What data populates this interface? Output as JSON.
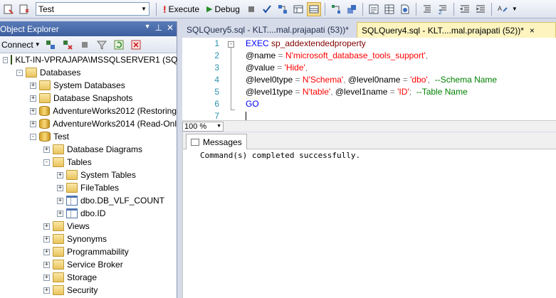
{
  "toolbar": {
    "database": "Test",
    "execute_label": "Execute",
    "debug_label": "Debug"
  },
  "object_explorer": {
    "title": "Object Explorer",
    "connect_label": "Connect",
    "nodes": [
      {
        "label": "KLT-IN-VPRAJAPA\\MSSQLSERVER1 (SQ",
        "expander": "-"
      },
      {
        "label": "Databases",
        "expander": "-"
      },
      {
        "label": "System Databases",
        "expander": "+"
      },
      {
        "label": "Database Snapshots",
        "expander": "+"
      },
      {
        "label": "AdventureWorks2012 (Restoring",
        "expander": "+"
      },
      {
        "label": "AdventureWorks2014 (Read-Onl",
        "expander": "+"
      },
      {
        "label": "Test",
        "expander": "-"
      },
      {
        "label": "Database Diagrams",
        "expander": "+"
      },
      {
        "label": "Tables",
        "expander": "-"
      },
      {
        "label": "System Tables",
        "expander": "+"
      },
      {
        "label": "FileTables",
        "expander": "+"
      },
      {
        "label": "dbo.DB_VLF_COUNT",
        "expander": "+"
      },
      {
        "label": "dbo.ID",
        "expander": "+"
      },
      {
        "label": "Views",
        "expander": "+"
      },
      {
        "label": "Synonyms",
        "expander": "+"
      },
      {
        "label": "Programmability",
        "expander": "+"
      },
      {
        "label": "Service Broker",
        "expander": "+"
      },
      {
        "label": "Storage",
        "expander": "+"
      },
      {
        "label": "Security",
        "expander": "+"
      }
    ]
  },
  "tabs": {
    "inactive": "SQLQuery5.sql - KLT....mal.prajapati (53))*",
    "active": "SQLQuery4.sql - KLT....mal.prajapati (52))*",
    "close": "×"
  },
  "editor": {
    "line_numbers": [
      "1",
      "2",
      "3",
      "4",
      "5",
      "6",
      "7"
    ],
    "line1_kw": "EXEC",
    "line1_proc": "sp_addextendedproperty",
    "line2_param": "@name",
    "line2_eq": " = ",
    "line2_val": "N'microsoft_database_tools_support'",
    "line2_comma": ",",
    "line3_param": "@value",
    "line3_eq": " = ",
    "line3_val": "'Hide'",
    "line3_comma": ",",
    "line4_param": "@level0type",
    "line4_eq": " = ",
    "line4_val": "N'Schema'",
    "line4_sep": ", ",
    "line4_param2": "@level0name",
    "line4_eq2": " = ",
    "line4_val2": "'dbo'",
    "line4_sep2": ",  ",
    "line4_comment": "--Schema Name",
    "line5_param": "@level1type",
    "line5_eq": " = ",
    "line5_val": "N'table'",
    "line5_sep": ", ",
    "line5_param2": "@level1name",
    "line5_eq2": " = ",
    "line5_val2": "'ID'",
    "line5_sep2": ";  ",
    "line5_comment": "--Table Name",
    "line6_kw": "GO"
  },
  "status": {
    "zoom": "100 %"
  },
  "results": {
    "tab_label": "Messages",
    "message": "Command(s) completed successfully."
  }
}
